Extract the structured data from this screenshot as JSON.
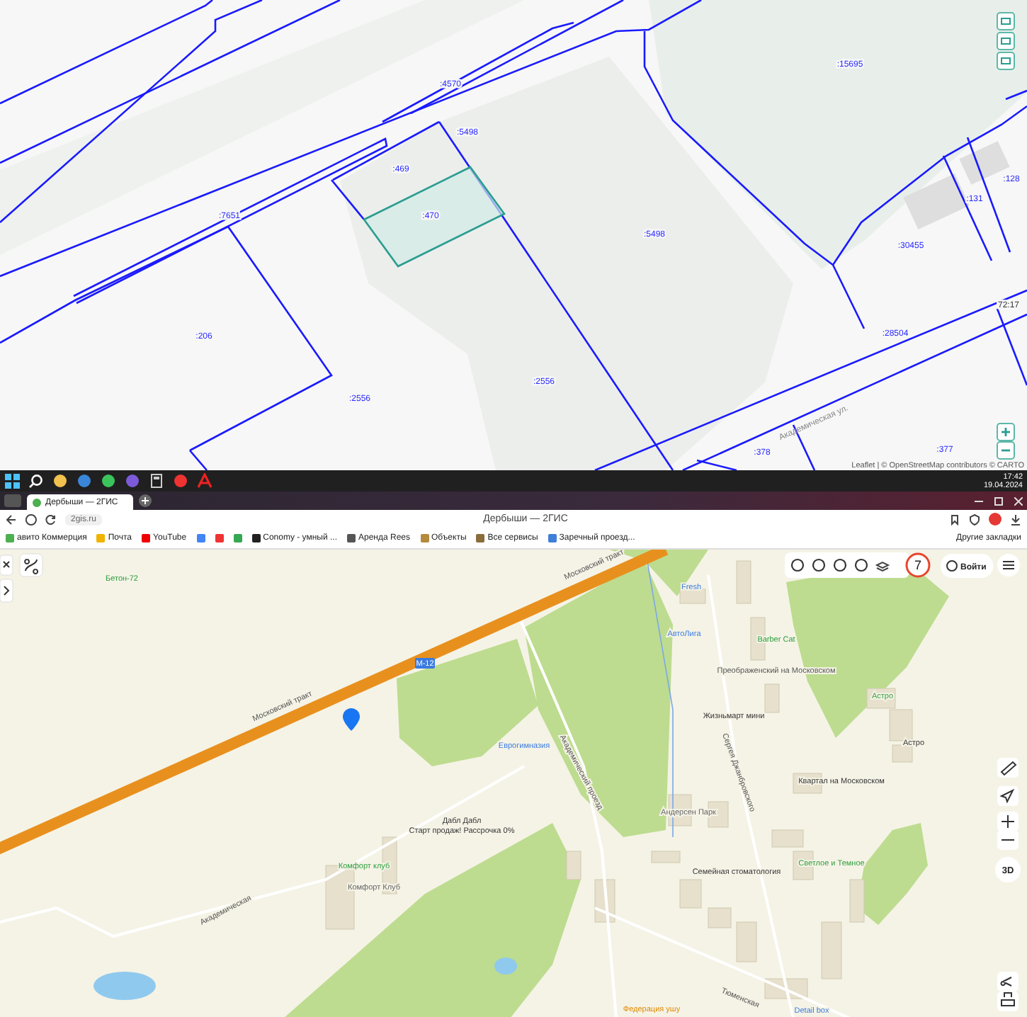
{
  "cadastral_map": {
    "parcel_labels": [
      ":15695",
      ":4570",
      ":5498",
      ":469",
      ":470",
      ":7651",
      ":5498",
      ":206",
      ":2556",
      ":2556",
      ":131",
      ":128",
      ":30455",
      ":28504",
      "72:17",
      ":378",
      ":377"
    ],
    "street": "Академическая ул.",
    "attribution": "Leaflet | © OpenStreetMap contributors © CARTO"
  },
  "taskbar": {
    "time": "17:42",
    "date": "19.04.2024"
  },
  "browser": {
    "tabs": [
      {
        "title": "Дербыши — 2ГИС",
        "selected": true
      }
    ],
    "url": "2gis.ru",
    "page_title": "Дербыши — 2ГИС",
    "bookmarks": [
      "авито Коммерция",
      "Почта",
      "YouTube",
      "Conomy - умный ...",
      "Аренда Rees",
      "Объекты",
      "Все сервисы",
      "Заречный проезд..."
    ],
    "other_bookmarks": "Другие закладки"
  },
  "gis_map": {
    "traffic_score": "7",
    "login": "Войти",
    "view_3d": "3D",
    "labels": [
      "Бетон-72",
      "Московский тракт",
      "Московский тракт",
      "М-12",
      "Fresh",
      "АвтоЛига",
      "Barber Cat",
      "Преображенский на Московском",
      "Жизньмарт мини",
      "Астро",
      "Астро",
      "Еврогимназия",
      "Академический проезд",
      "Сергея Джанбровского",
      "Квартал на Московском",
      "Андерсен Парк",
      "Дабл Дабл",
      "Старт продаж! Рассрочка 0%",
      "Комфорт клуб",
      "Комфорт Клуб",
      "Академическая",
      "Семейная стоматология",
      "Светлое и Темное",
      "Тюменская",
      "Федерация ушу",
      "Detail box"
    ]
  }
}
